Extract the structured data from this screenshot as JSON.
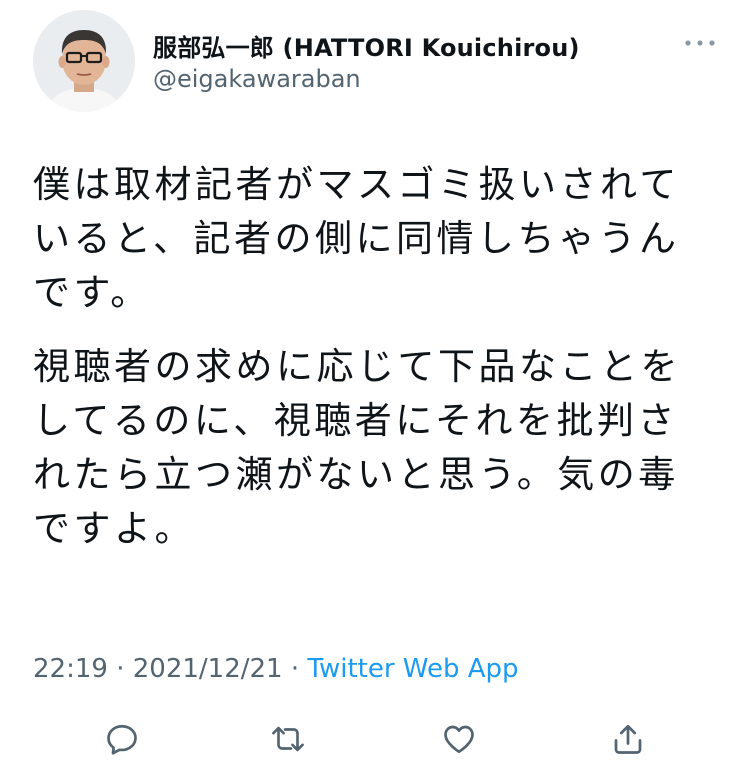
{
  "author": {
    "display_name": "服部弘一郎 (HATTORI Kouichirou)",
    "handle": "@eigakawaraban"
  },
  "tweet": {
    "paragraphs": [
      "僕は取材記者がマスゴミ扱いされていると、記者の側に同情しちゃうんです。",
      "視聴者の求めに応じて下品なことをしてるのに、視聴者にそれを批判されたら立つ瀬がないと思う。気の毒ですよ。"
    ],
    "time": "22:19",
    "date": "2021/12/21",
    "separator": "·",
    "source": "Twitter Web App"
  },
  "icons": {
    "more": "more-horizontal-icon",
    "reply": "reply-icon",
    "retweet": "retweet-icon",
    "like": "like-icon",
    "share": "share-icon"
  },
  "colors": {
    "text": "#0f1419",
    "secondary": "#536471",
    "link": "#1d9bf0"
  }
}
